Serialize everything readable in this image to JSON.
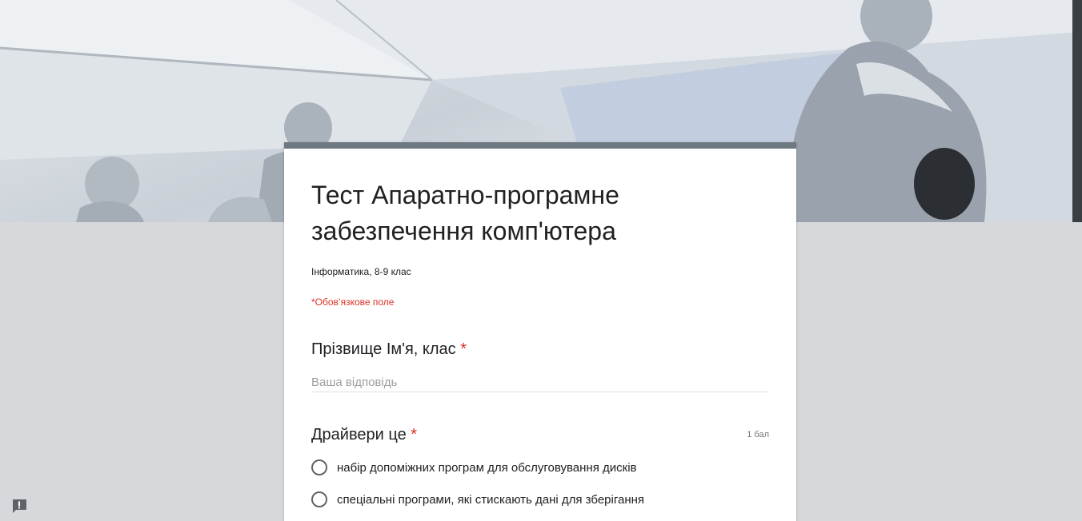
{
  "banner": {
    "image": "mannequins-header-image"
  },
  "form": {
    "title": "Тест Апаратно-програмне забезпечення комп'ютера",
    "description": "Інформатика, 8-9 клас",
    "required_note": "*Обов’язкове поле"
  },
  "questions": [
    {
      "title": "Прізвище Ім'я, клас",
      "required_mark": "*",
      "placeholder": "Ваша відповідь"
    },
    {
      "title": "Драйвери це",
      "required_mark": "*",
      "points": "1 бал",
      "options": [
        "набір допоміжних програм для обслуговування дисків",
        "спеціальні програми, які стискають дані для зберігання"
      ]
    }
  ],
  "feedback": {
    "icon": "report-problem-icon"
  },
  "colors": {
    "accent": "#6e7881",
    "required": "#d93025",
    "background": "#d6d8db"
  }
}
